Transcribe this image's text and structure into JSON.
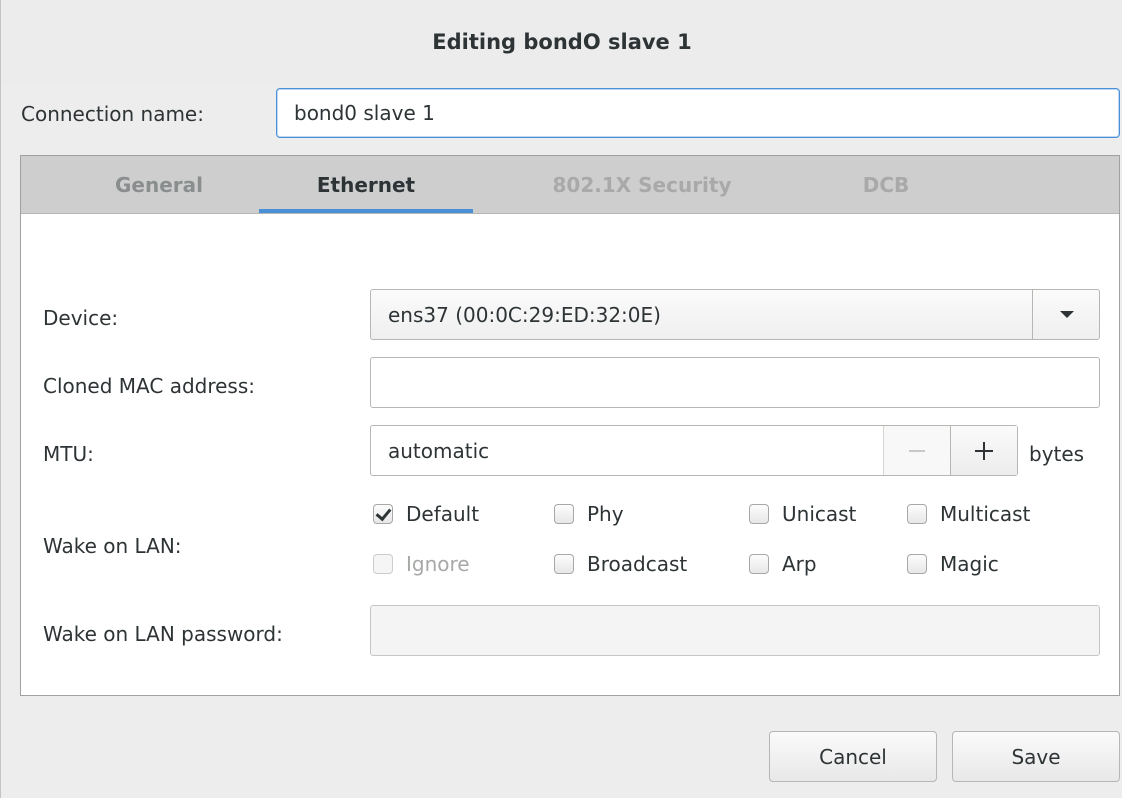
{
  "window": {
    "title": "Editing bondO slave 1"
  },
  "connection": {
    "label": "Connection name:",
    "value": "bond0 slave 1"
  },
  "tabs": [
    {
      "label": "General",
      "state": "normal"
    },
    {
      "label": "Ethernet",
      "state": "active"
    },
    {
      "label": "802.1X Security",
      "state": "disabled"
    },
    {
      "label": "DCB",
      "state": "disabled"
    }
  ],
  "ethernet": {
    "device": {
      "label": "Device:",
      "value": "ens37 (00:0C:29:ED:32:0E)"
    },
    "cloned_mac": {
      "label": "Cloned MAC address:",
      "value": ""
    },
    "mtu": {
      "label": "MTU:",
      "value": "automatic",
      "unit": "bytes"
    },
    "wake_on_lan": {
      "label": "Wake on LAN:",
      "options": [
        {
          "label": "Default",
          "checked": true,
          "disabled": false
        },
        {
          "label": "Phy",
          "checked": false,
          "disabled": false
        },
        {
          "label": "Unicast",
          "checked": false,
          "disabled": false
        },
        {
          "label": "Multicast",
          "checked": false,
          "disabled": false
        },
        {
          "label": "Ignore",
          "checked": false,
          "disabled": true
        },
        {
          "label": "Broadcast",
          "checked": false,
          "disabled": false
        },
        {
          "label": "Arp",
          "checked": false,
          "disabled": false
        },
        {
          "label": "Magic",
          "checked": false,
          "disabled": false
        }
      ]
    },
    "wol_password": {
      "label": "Wake on LAN password:",
      "value": ""
    }
  },
  "buttons": {
    "cancel": "Cancel",
    "save": "Save"
  },
  "colors": {
    "accent": "#4a90d9",
    "text": "#2e3436",
    "tabbar": "#cecece",
    "background": "#ededed"
  }
}
